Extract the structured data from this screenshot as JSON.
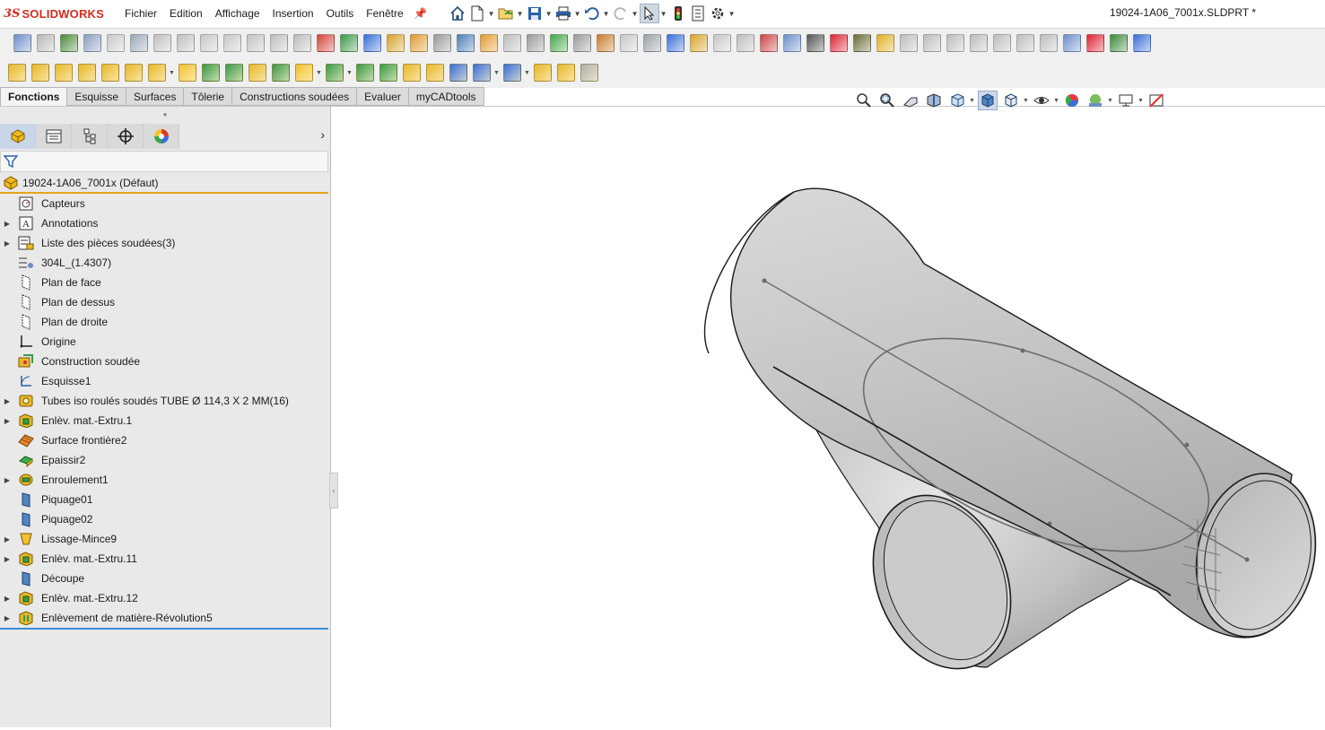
{
  "app": {
    "logo_prefix": "3S",
    "logo_name": "SOLIDWORKS",
    "document_title": "19024-1A06_7001x.SLDPRT *"
  },
  "menu": [
    "Fichier",
    "Edition",
    "Affichage",
    "Insertion",
    "Outils",
    "Fenêtre"
  ],
  "command_tabs": [
    "Fonctions",
    "Esquisse",
    "Surfaces",
    "Tôlerie",
    "Constructions soudées",
    "Evaluer",
    "myCADtools"
  ],
  "feature_tree": {
    "root": "19024-1A06_7001x (Défaut)",
    "items": [
      {
        "label": "Capteurs",
        "expandable": false,
        "icon": "sensor-icon"
      },
      {
        "label": "Annotations",
        "expandable": true,
        "icon": "annotation-icon"
      },
      {
        "label": "Liste des pièces soudées(3)",
        "expandable": true,
        "icon": "cut-list-icon"
      },
      {
        "label": "304L_(1.4307)",
        "expandable": false,
        "icon": "material-icon"
      },
      {
        "label": "Plan de face",
        "expandable": false,
        "icon": "plane-icon"
      },
      {
        "label": "Plan de dessus",
        "expandable": false,
        "icon": "plane-icon"
      },
      {
        "label": "Plan de droite",
        "expandable": false,
        "icon": "plane-icon"
      },
      {
        "label": "Origine",
        "expandable": false,
        "icon": "origin-icon"
      },
      {
        "label": "Construction soudée",
        "expandable": false,
        "icon": "weldment-icon"
      },
      {
        "label": "Esquisse1",
        "expandable": false,
        "icon": "sketch-icon"
      },
      {
        "label": "Tubes iso roulés soudés TUBE Ø 114,3 X 2 MM(16)",
        "expandable": true,
        "icon": "structural-member-icon"
      },
      {
        "label": "Enlèv. mat.-Extru.1",
        "expandable": true,
        "icon": "extruded-cut-icon"
      },
      {
        "label": "Surface frontière2",
        "expandable": false,
        "icon": "boundary-surface-icon"
      },
      {
        "label": "Epaissir2",
        "expandable": false,
        "icon": "thicken-icon"
      },
      {
        "label": "Enroulement1",
        "expandable": true,
        "icon": "wrap-icon"
      },
      {
        "label": "Piquage01",
        "expandable": false,
        "icon": "split-plane-icon"
      },
      {
        "label": "Piquage02",
        "expandable": false,
        "icon": "split-plane-icon"
      },
      {
        "label": "Lissage-Mince9",
        "expandable": true,
        "icon": "loft-icon"
      },
      {
        "label": "Enlèv. mat.-Extru.11",
        "expandable": true,
        "icon": "extruded-cut-icon"
      },
      {
        "label": "Découpe",
        "expandable": false,
        "icon": "split-plane-icon"
      },
      {
        "label": "Enlèv. mat.-Extru.12",
        "expandable": true,
        "icon": "extruded-cut-icon"
      },
      {
        "label": "Enlèvement de matière-Révolution5",
        "expandable": true,
        "icon": "revolved-cut-icon"
      }
    ]
  },
  "colors": {
    "accent_orange": "#e8a317",
    "accent_blue": "#3b8fd6",
    "brand_red": "#d52b1e",
    "model_gray": "#cfcfcf"
  }
}
